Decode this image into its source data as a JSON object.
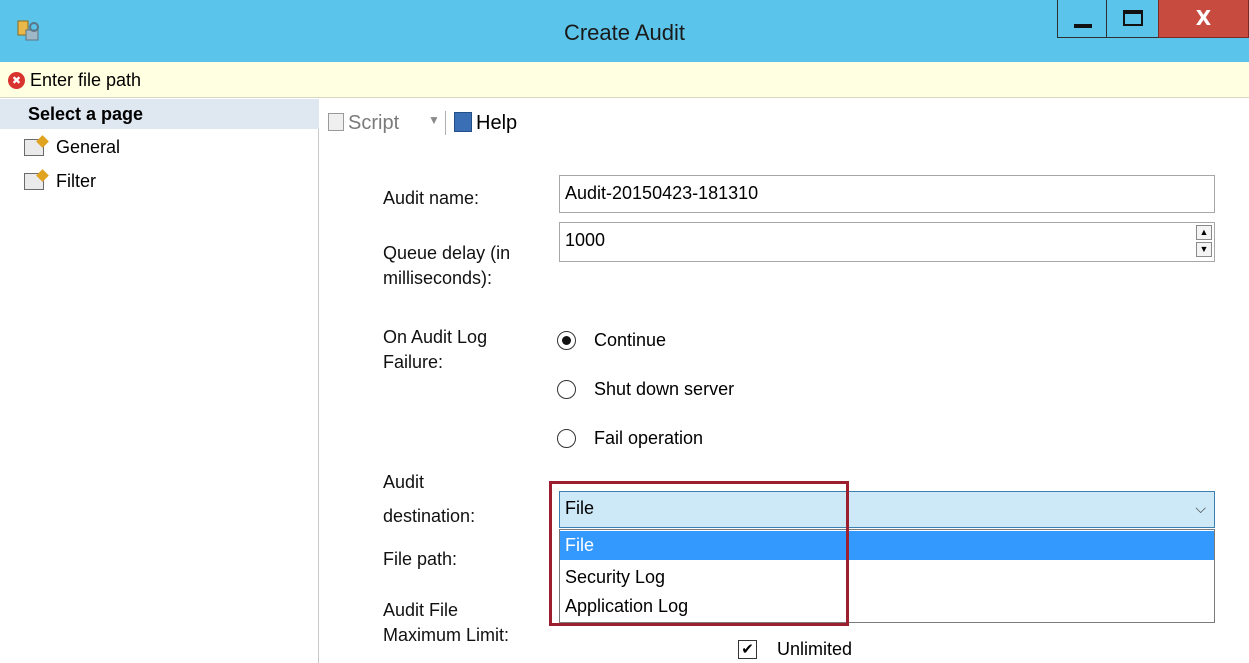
{
  "window": {
    "title": "Create Audit",
    "close_glyph": "X"
  },
  "error": {
    "message": "Enter file path",
    "icon_glyph": "✖"
  },
  "left_pane": {
    "header": "Select a page",
    "pages": [
      {
        "label": "General"
      },
      {
        "label": "Filter"
      }
    ]
  },
  "toolbar": {
    "script_label": "Script",
    "help_label": "Help"
  },
  "form": {
    "audit_name_label": "Audit name:",
    "audit_name_value": "Audit-20150423-181310",
    "queue_delay_label_1": "Queue delay (in",
    "queue_delay_label_2": "milliseconds):",
    "queue_delay_value": "1000",
    "on_failure_label_1": "On Audit Log",
    "on_failure_label_2": "Failure:",
    "on_failure_options": [
      {
        "label": "Continue",
        "selected": true
      },
      {
        "label": "Shut down server",
        "selected": false
      },
      {
        "label": "Fail operation",
        "selected": false
      }
    ],
    "destination_label_1": "Audit",
    "destination_label_2": "destination:",
    "destination_value": "File",
    "destination_options": [
      "File",
      "Security Log",
      "Application Log"
    ],
    "file_path_label": "File path:",
    "max_limit_label_1": "Audit File",
    "max_limit_label_2": "Maximum Limit:",
    "unlimited_label": "Unlimited",
    "unlimited_checked": true
  },
  "colors": {
    "titlebar": "#5bc4ea",
    "close_button": "#c84b3f",
    "error_bar": "#ffffe1",
    "selection": "#3399ff",
    "highlight_box": "#9c1f2f"
  }
}
